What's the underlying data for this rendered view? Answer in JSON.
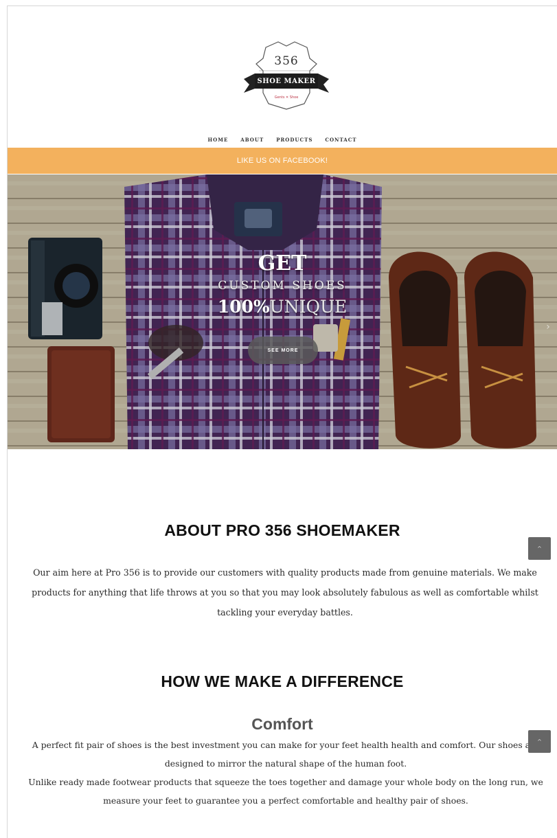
{
  "logo": {
    "number": "356",
    "name": "SHOE MAKER",
    "tagline": "Gents ✕ Shoe"
  },
  "nav": {
    "items": [
      "HOME",
      "ABOUT",
      "PRODUCTS",
      "CONTACT"
    ]
  },
  "banner": {
    "text": "LIKE US ON FACEBOOK!",
    "color": "#f3b15d"
  },
  "hero": {
    "line1": "GET",
    "line2": "CUSTOM SHOES",
    "line3_bold": "100%",
    "line3_thin": "UNIQUE",
    "button": "SEE MORE",
    "next_icon": "chevron-right-icon"
  },
  "about": {
    "title": "ABOUT PRO 356 SHOEMAKER",
    "text": "Our aim here at Pro 356 is to provide our customers with quality products made from genuine materials. We make products for anything that life throws at you so that you may look absolutely fabulous as well as comfortable whilst tackling your everyday battles."
  },
  "difference": {
    "title": "HOW WE MAKE A DIFFERENCE",
    "feature_title": "Comfort",
    "feature_text_1": "A perfect fit pair of shoes is the best investment you can make for your feet health health and comfort. Our shoes are designed to mirror the natural shape of the human foot.",
    "feature_text_2": "Unlike ready made footwear products that squeeze the toes together and damage your whole body on the long run, we measure your feet to guarantee you a perfect comfortable and healthy pair of shoes."
  },
  "scroll_buttons": {
    "icon": "arrow-up-icon",
    "glyph": "^"
  }
}
